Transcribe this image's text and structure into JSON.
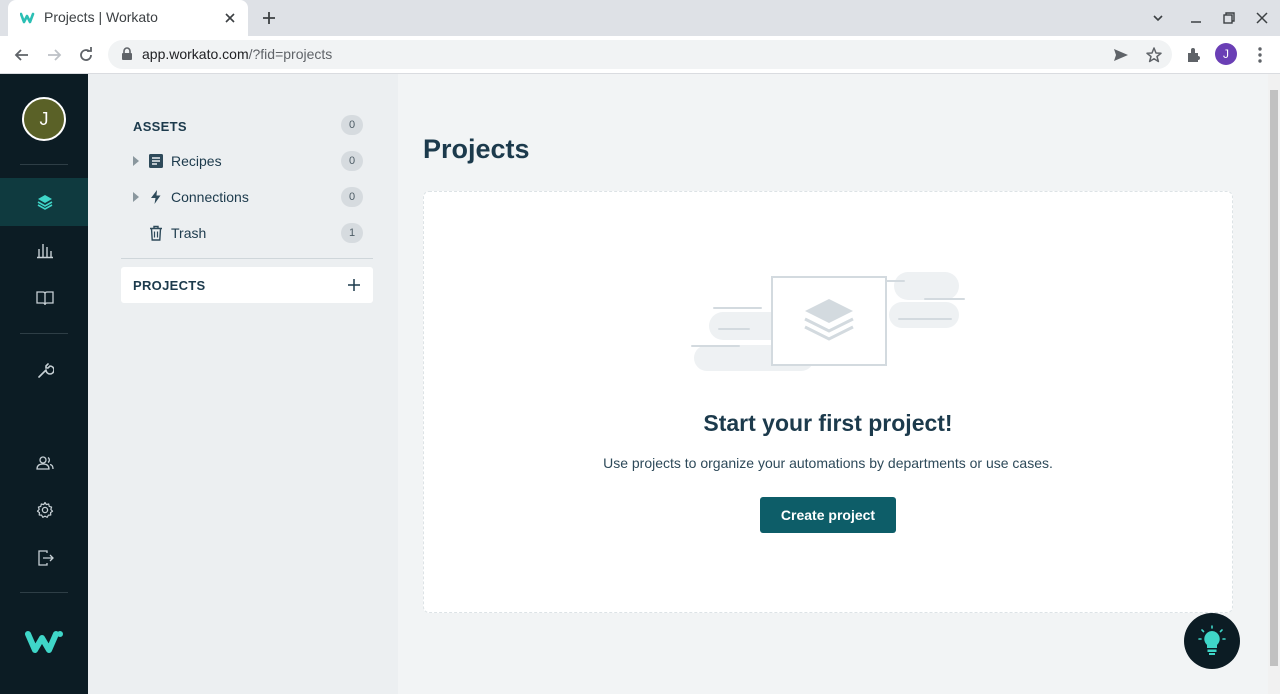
{
  "browser": {
    "tab_title": "Projects | Workato",
    "url_host": "app.workato.com",
    "url_path": "/?fid=projects",
    "profile_initial": "J"
  },
  "nav": {
    "user_initial": "J"
  },
  "assets": {
    "heading": "ASSETS",
    "total_count": "0",
    "items": [
      {
        "label": "Recipes",
        "count": "0",
        "icon": "recipe-icon"
      },
      {
        "label": "Connections",
        "count": "0",
        "icon": "lightning-icon"
      },
      {
        "label": "Trash",
        "count": "1",
        "icon": "trash-icon"
      }
    ],
    "projects_heading": "PROJECTS"
  },
  "main": {
    "title": "Projects",
    "empty_title": "Start your first project!",
    "empty_description": "Use projects to organize your automations by departments or use cases.",
    "create_button": "Create project"
  },
  "colors": {
    "accent": "#0d5d68",
    "nav_bg": "#0c1c24",
    "brand": "#3fd6c8"
  }
}
